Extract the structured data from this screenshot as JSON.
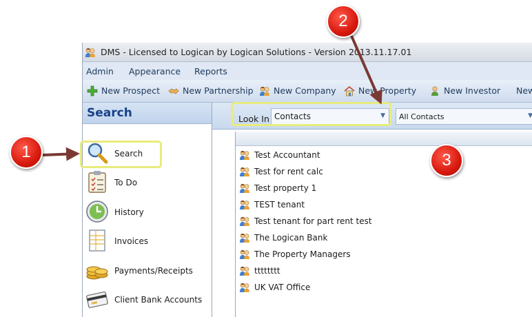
{
  "window": {
    "title": "DMS - Licensed to Logican by Logican Solutions - Version 2013.11.17.01",
    "app_icon": "contact-people-icon"
  },
  "menu": [
    "Admin",
    "Appearance",
    "Reports"
  ],
  "toolbar": {
    "new_prospect": "New Prospect",
    "new_partnership": "New Partnership",
    "new_company": "New Company",
    "new_property": "New Property",
    "new_investor": "New Investor",
    "new_more": "New"
  },
  "left_panel": {
    "title": "Search",
    "items": [
      {
        "label": "Search",
        "icon": "magnifier-icon"
      },
      {
        "label": "To Do",
        "icon": "clipboard-checklist-icon"
      },
      {
        "label": "History",
        "icon": "clock-icon"
      },
      {
        "label": "Invoices",
        "icon": "invoice-icon"
      },
      {
        "label": "Payments/Receipts",
        "icon": "coins-icon"
      },
      {
        "label": "Client Bank Accounts",
        "icon": "bank-card-icon"
      }
    ]
  },
  "filter": {
    "look_in_label": "Look In",
    "look_in_value": "Contacts",
    "scope_value": "All Contacts"
  },
  "results": [
    "Test Accountant",
    "Test for rent calc",
    "Test property 1",
    "TEST tenant",
    "Test tenant for part rent test",
    "The Logican Bank",
    "The Property Managers",
    "tttttttt",
    "UK VAT Office"
  ],
  "callouts": [
    "1",
    "2",
    "3"
  ],
  "colors": {
    "highlight": "#e8ec7d",
    "callout": "#d8190e",
    "panel_header": "#15428b"
  }
}
